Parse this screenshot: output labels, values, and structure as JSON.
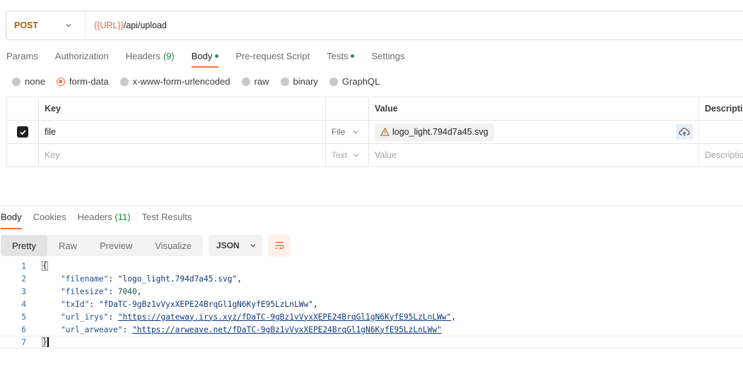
{
  "request": {
    "method": "POST",
    "url_variable": "{{URL}}",
    "url_path": "/api/upload"
  },
  "request_tabs": [
    {
      "label": "Params"
    },
    {
      "label": "Authorization"
    },
    {
      "label": "Headers",
      "count": "(9)"
    },
    {
      "label": "Body",
      "active": true,
      "dot": true
    },
    {
      "label": "Pre-request Script"
    },
    {
      "label": "Tests",
      "dot": true
    },
    {
      "label": "Settings"
    }
  ],
  "body_types": [
    "none",
    "form-data",
    "x-www-form-urlencoded",
    "raw",
    "binary",
    "GraphQL"
  ],
  "body_type_selected": "form-data",
  "form_table": {
    "headers": {
      "key": "Key",
      "value": "Value",
      "description": "Description"
    },
    "rows": [
      {
        "checked": true,
        "key": "file",
        "type": "File",
        "value": "logo_light.794d7a45.svg",
        "description": ""
      }
    ],
    "placeholder": {
      "key": "Key",
      "type": "Text",
      "value": "Value",
      "description": "Description"
    }
  },
  "response_tabs": [
    {
      "label": "Body",
      "active": true
    },
    {
      "label": "Cookies"
    },
    {
      "label": "Headers",
      "count": "(11)"
    },
    {
      "label": "Test Results"
    }
  ],
  "view_modes": [
    "Pretty",
    "Raw",
    "Preview",
    "Visualize"
  ],
  "view_mode_selected": "Pretty",
  "format": "JSON",
  "response_json": {
    "lines": [
      {
        "num": "1"
      },
      {
        "num": "2",
        "key": "\"filename\"",
        "value": "\"logo_light.794d7a45.svg\"",
        "vtype": "string",
        "comma": ","
      },
      {
        "num": "3",
        "key": "\"filesize\"",
        "value": "7040",
        "vtype": "number",
        "comma": ","
      },
      {
        "num": "4",
        "key": "\"txId\"",
        "value": "\"fDaTC-9gBz1vVyxXEPE24BrqGl1gN6KyfE95LzLnLWw\"",
        "vtype": "string",
        "comma": ","
      },
      {
        "num": "5",
        "key": "\"url_irys\"",
        "value": "\"https://gateway.irys.xyz/fDaTC-9gBz1vVyxXEPE24BrqGl1gN6KyfE95LzLnLWw\"",
        "vtype": "url",
        "comma": ","
      },
      {
        "num": "6",
        "key": "\"url_arweave\"",
        "value": "\"https://arweave.net/fDaTC-9gBz1vVyxXEPE24BrqGl1gN6KyfE95LzLnLWw\"",
        "vtype": "url",
        "comma": ""
      },
      {
        "num": "7"
      }
    ],
    "open_brace": "{",
    "close_brace": "}"
  },
  "colors": {
    "accent": "#ff6c37",
    "method": "#a0670a",
    "url_variable": "#e5694a",
    "status_dot": "#1a9a4b"
  }
}
